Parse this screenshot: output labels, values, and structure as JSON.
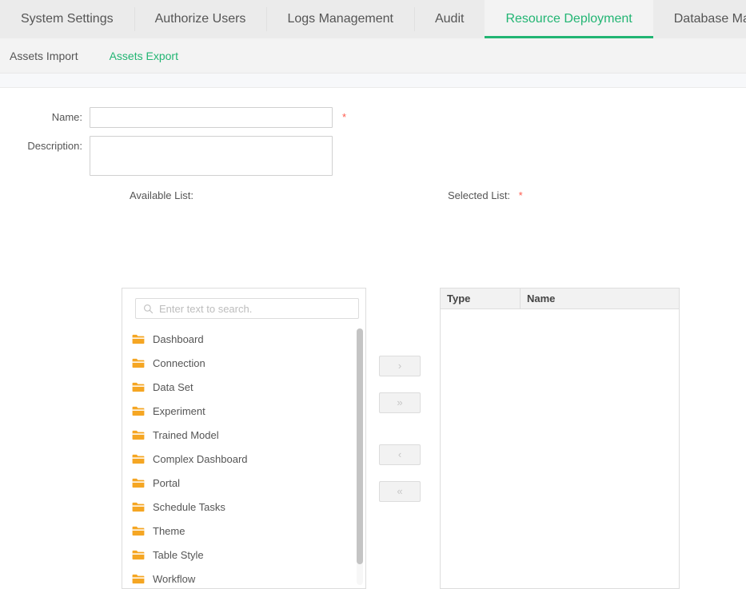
{
  "main_tabs": [
    {
      "label": "System Settings",
      "active": false
    },
    {
      "label": "Authorize Users",
      "active": false
    },
    {
      "label": "Logs Management",
      "active": false
    },
    {
      "label": "Audit",
      "active": false
    },
    {
      "label": "Resource Deployment",
      "active": true
    },
    {
      "label": "Database Management",
      "active": false
    }
  ],
  "sub_tabs": [
    {
      "label": "Assets Import",
      "active": false
    },
    {
      "label": "Assets Export",
      "active": true
    }
  ],
  "form": {
    "name_label": "Name:",
    "name_value": "",
    "name_placeholder": "",
    "name_required_mark": "*",
    "description_label": "Description:",
    "description_value": "",
    "description_placeholder": ""
  },
  "available": {
    "caption": "Available List:",
    "search_placeholder": "Enter text to search.",
    "search_value": "",
    "search_icon": "search-icon",
    "items": [
      {
        "icon": "folder-icon",
        "label": "Dashboard"
      },
      {
        "icon": "folder-icon",
        "label": "Connection"
      },
      {
        "icon": "folder-icon",
        "label": "Data Set"
      },
      {
        "icon": "folder-icon",
        "label": "Experiment"
      },
      {
        "icon": "folder-icon",
        "label": "Trained Model"
      },
      {
        "icon": "folder-icon",
        "label": "Complex Dashboard"
      },
      {
        "icon": "folder-icon",
        "label": "Portal"
      },
      {
        "icon": "folder-icon",
        "label": "Schedule Tasks"
      },
      {
        "icon": "folder-icon",
        "label": "Theme"
      },
      {
        "icon": "folder-icon",
        "label": "Table Style"
      },
      {
        "icon": "folder-icon",
        "label": "Workflow"
      }
    ]
  },
  "transfer_buttons": [
    {
      "label": "›",
      "name": "move-right-button",
      "disabled": true
    },
    {
      "label": "»",
      "name": "move-all-right-button",
      "disabled": true
    },
    {
      "label": "‹",
      "name": "move-left-button",
      "disabled": true
    },
    {
      "label": "«",
      "name": "move-all-left-button",
      "disabled": true
    }
  ],
  "selected": {
    "caption": "Selected List:",
    "required_mark": "*",
    "columns": [
      "Type",
      "Name"
    ],
    "rows": []
  },
  "colors": {
    "accent_green": "#22b573",
    "required_red": "#ff5a4d",
    "folder_orange": "#f5a623",
    "tabbar_bg": "#ebebeb",
    "subnav_bg": "#f3f3f3",
    "band_bg": "#f7f8fa",
    "border_gray": "#dddddd"
  }
}
